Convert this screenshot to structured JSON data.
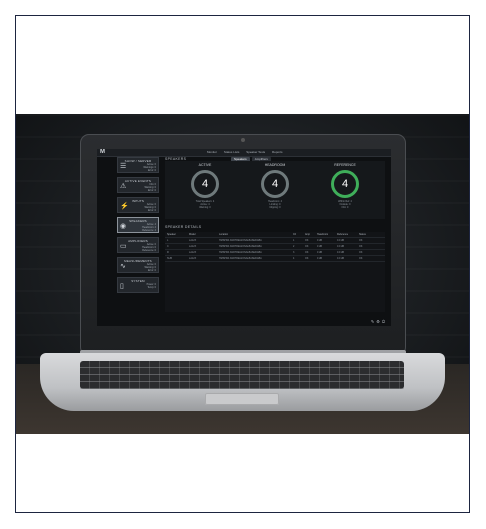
{
  "app": {
    "logo": "M",
    "menu": [
      "Monitor",
      "Status Lists",
      "Speaker Tests",
      "Reports"
    ],
    "tabs": [
      {
        "label": "Speakers",
        "active": true
      },
      {
        "label": "Amplifiers",
        "active": false
      }
    ]
  },
  "sidebar": {
    "cards": [
      {
        "title": "SHOW / SERVER",
        "icon": "list-icon",
        "rows": [
          "Active: 0",
          "Warnings: 0",
          "Error: 0"
        ],
        "selected": false
      },
      {
        "title": "ACTIVE EVENTS",
        "icon": "warning-icon",
        "rows": [
          "Info: 0",
          "Warning: 0",
          "Error: 0"
        ],
        "selected": false
      },
      {
        "title": "INPUTS",
        "icon": "plug-icon",
        "rows": [
          "Active: 0",
          "Warning: 0",
          "Error: 0"
        ],
        "selected": false
      },
      {
        "title": "SPEAKERS",
        "icon": "speaker-icon",
        "rows": [
          "Active: 4",
          "Headroom: 4",
          "Reference: 4"
        ],
        "selected": true
      },
      {
        "title": "AMPLIFIERS",
        "icon": "amp-icon",
        "rows": [
          "Active: 0",
          "Headroom: 0",
          "Reference: 0"
        ],
        "selected": false
      },
      {
        "title": "MEASUREMENTS",
        "icon": "waveform-icon",
        "rows": [
          "Active: 0",
          "Warning: 0",
          "Error: 0"
        ],
        "selected": false
      },
      {
        "title": "SYSTEM",
        "icon": "device-icon",
        "rows": [
          "Power: 0",
          "Temp: 0"
        ],
        "selected": false
      }
    ]
  },
  "speakers": {
    "title": "SPEAKERS",
    "gauges": [
      {
        "label": "ACTIVE",
        "value": "4",
        "color": "#6f7a7c",
        "stats": [
          "Total Speakers: 4",
          "Active: 4",
          "Warning: 0"
        ]
      },
      {
        "label": "HEADROOM",
        "value": "4",
        "color": "#6f7a7c",
        "stats": [
          "Headroom: 4",
          "Limiting: 0",
          "Clipping: 0"
        ]
      },
      {
        "label": "REFERENCE",
        "value": "4",
        "color": "#3fae5a",
        "stats": [
          "Within Ref: 4",
          "Outside: 0",
          "N/A: 0"
        ]
      }
    ]
  },
  "details": {
    "title": "SPEAKER DETAILS",
    "columns": [
      "Speaker",
      "Model",
      "Location",
      "Ch",
      "Amp",
      "Headroom",
      "Reference",
      "Status"
    ],
    "rows": [
      [
        "L",
        "LA12X",
        "HMSPKR ANDTREGIONALBASEDGBA",
        "1",
        "OK",
        "0 dB",
        "0.0 dB",
        "OK"
      ],
      [
        "C",
        "LA12X",
        "HMSPKR ANDTREGIONALBASEDGBA",
        "2",
        "OK",
        "0 dB",
        "0.0 dB",
        "OK"
      ],
      [
        "R",
        "LA12X",
        "HMSPKR ANDTREGIONALBASEDGBA",
        "3",
        "OK",
        "0 dB",
        "0.0 dB",
        "OK"
      ],
      [
        "SUB",
        "LA12X",
        "HMSPKR ANDTREGIONALBASEDGBA",
        "4",
        "OK",
        "0 dB",
        "0.0 dB",
        "OK"
      ]
    ]
  }
}
